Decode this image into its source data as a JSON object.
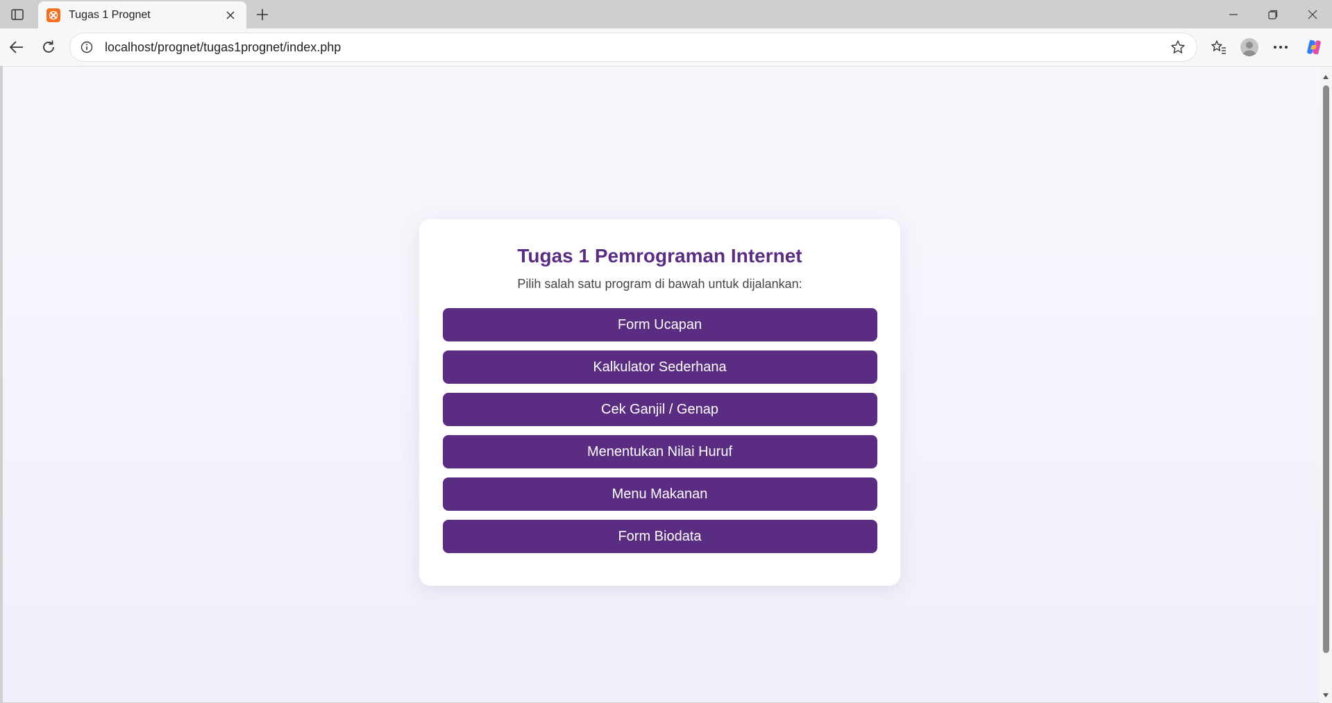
{
  "browser": {
    "tab": {
      "title": "Tugas 1 Prognet",
      "favicon": "xampp-icon"
    },
    "address_bar": {
      "url": "localhost/prognet/tugas1prognet/index.php"
    }
  },
  "page": {
    "title": "Tugas 1 Pemrograman Internet",
    "subtitle": "Pilih salah satu program di bawah untuk dijalankan:",
    "buttons": [
      {
        "label": "Form Ucapan"
      },
      {
        "label": "Kalkulator Sederhana"
      },
      {
        "label": "Cek Ganjil / Genap"
      },
      {
        "label": "Menentukan Nilai Huruf"
      },
      {
        "label": "Menu Makanan"
      },
      {
        "label": "Form Biodata"
      }
    ]
  },
  "colors": {
    "accent": "#5a2d82",
    "button_text": "#ffffff",
    "subtitle": "#444444",
    "page_background": "#f5f3fb"
  }
}
